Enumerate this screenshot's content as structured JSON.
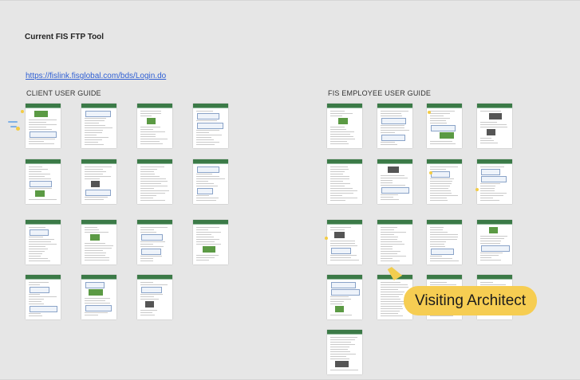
{
  "board": {
    "title": "Current FIS FTP Tool",
    "link": "https://fislink.fisglobal.com/bds/Login.do"
  },
  "sections": [
    {
      "id": "client",
      "heading": "CLIENT USER GUIDE",
      "page_count": 15
    },
    {
      "id": "employee",
      "heading": "FIS EMPLOYEE USER GUIDE",
      "page_count": 17
    }
  ],
  "collaborator": {
    "name": "Visiting Architect",
    "color": "#f6cd52"
  },
  "colors": {
    "page_header": "#3b7a47",
    "link": "#2f5fd3",
    "board": "#e6e6e6"
  }
}
